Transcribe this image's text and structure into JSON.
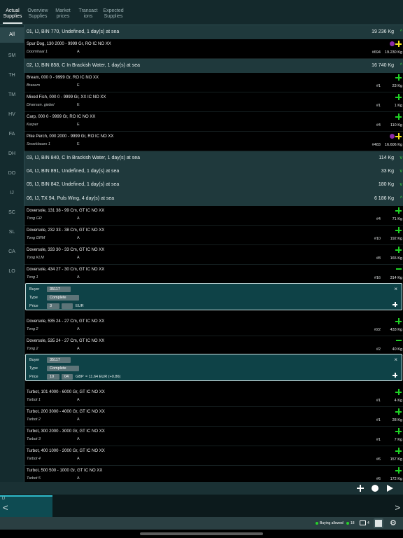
{
  "tabs": [
    {
      "label": "Actual\nSupplies",
      "active": true
    },
    {
      "label": "Overview\nSupplies"
    },
    {
      "label": "Market\nprices"
    },
    {
      "label": "Transact\nions"
    },
    {
      "label": "Expected\nSupplies"
    }
  ],
  "sidebar": [
    "All",
    "SM",
    "TH",
    "TM",
    "HV",
    "FA",
    "DH",
    "DO",
    "IJ",
    "SC",
    "SL",
    "CA",
    "LO"
  ],
  "groups": [
    {
      "title": "01, IJ, BIN 770, Undefined, 1 day(s) at sea",
      "weight": "19 236 Kg",
      "chevron": "^"
    },
    {
      "title": "02, IJ, BIN 858, C In Brackish Water, 1 day(s) at sea",
      "weight": "16 740 Kg",
      "chevron": "^"
    },
    {
      "title": "03, IJ, BIN 840, C In Brackish Water, 1 day(s) at sea",
      "weight": "114 Kg",
      "chevron": "v"
    },
    {
      "title": "04, IJ, BIN 891, Undefined, 1 day(s) at sea",
      "weight": "33 Kg",
      "chevron": "v"
    },
    {
      "title": "05, IJ, BIN 842, Undefined, 1 day(s) at sea",
      "weight": "180 Kg",
      "chevron": "v"
    },
    {
      "title": "06, IJ, TX 94, Puls Wing, 4 day(s) at sea",
      "weight": "6 186 Kg",
      "chevron": "^"
    }
  ],
  "rows": [
    {
      "name": "Spur Dog, 130 2000 - 9999 Gr, RO IC NO XX",
      "sub": "Doornhaai 1",
      "q": "A",
      "hash": "#694",
      "weight": "19.230 Kg",
      "icon": "plus-y",
      "dot": true
    },
    {
      "name": "Bream, 000 0 - 9999 Gr, RO IC NO XX",
      "sub": "Brasem",
      "q": "E",
      "hash": "#1",
      "weight": "23 Kg",
      "icon": "plus"
    },
    {
      "name": "Mixed Fish, 000 0 - 9999 Gr, XX IC NO XX",
      "sub": "Diversen. giebel",
      "q": "E",
      "hash": "#1",
      "weight": "1 Kg",
      "icon": "plus"
    },
    {
      "name": "Carp, 000 0 - 9999 Gr, RO IC NO XX",
      "sub": "Karper",
      "q": "E",
      "hash": "#4",
      "weight": "110 Kg",
      "icon": "plus"
    },
    {
      "name": "Pike Perch, 000 2000 - 9999 Gr, RO IC NO XX",
      "sub": "Snoekbaars 1",
      "q": "E",
      "hash": "#483",
      "weight": "16.606 Kg",
      "icon": "plus-y",
      "dot": true
    },
    {
      "name": "Doversole, 131 38 - 99 Cm, GT IC NO XX",
      "sub": "Tong GR",
      "q": "A",
      "hash": "#4",
      "weight": "71 Kg",
      "icon": "plus"
    },
    {
      "name": "Doversole, 232 33 - 38 Cm, GT IC NO XX",
      "sub": "Tong GRM",
      "q": "A",
      "hash": "#10",
      "weight": "192 Kg",
      "icon": "plus"
    },
    {
      "name": "Doversole, 333 30 - 33 Cm, GT IC NO XX",
      "sub": "Tong KLM",
      "q": "A",
      "hash": "#8",
      "weight": "165 Kg",
      "icon": "plus"
    },
    {
      "name": "Doversole, 434 27 - 30 Cm, GT IC NO XX",
      "sub": "Tong 1",
      "q": "A",
      "hash": "#16",
      "weight": "314 Kg",
      "icon": "minus"
    },
    {
      "name": "Doversole, 535 24 - 27 Cm, GT IC NO XX",
      "sub": "Tong 2",
      "q": "A",
      "hash": "#22",
      "weight": "433 Kg",
      "icon": "plus"
    },
    {
      "name": "Doversole, 535 24 - 27 Cm, GT IC NO XX",
      "sub": "Tong 2",
      "q": "A",
      "hash": "#2",
      "weight": "40 Kg",
      "icon": "minus"
    },
    {
      "name": "Turbot, 101 4000 - 6000 Gr, GT IC NO XX",
      "sub": "Tarbot 1",
      "q": "A",
      "hash": "#1",
      "weight": "4 Kg",
      "icon": "plus"
    },
    {
      "name": "Turbot, 200 3000 - 4000 Gr, GT IC NO XX",
      "sub": "Tarbot 2",
      "q": "A",
      "hash": "#1",
      "weight": "28 Kg",
      "icon": "plus"
    },
    {
      "name": "Turbot, 300 2000 - 3000 Gr, GT IC NO XX",
      "sub": "Tarbot 3",
      "q": "A",
      "hash": "#1",
      "weight": "7 Kg",
      "icon": "plus"
    },
    {
      "name": "Turbot, 400 1000 - 2000 Gr, GT IC NO XX",
      "sub": "Tarbot 4",
      "q": "A",
      "hash": "#6",
      "weight": "157 Kg",
      "icon": "plus"
    },
    {
      "name": "Turbot, 500 500 - 1000 Gr, GT IC NO XX",
      "sub": "Tarbot 5",
      "q": "A",
      "hash": "#6",
      "weight": "172 Kg",
      "icon": "plus"
    }
  ],
  "bid_labels": {
    "buyer": "Buyer",
    "type": "Type",
    "price": "Price",
    "close": "×"
  },
  "bids": [
    {
      "buyer": "35117",
      "type": "Complete",
      "price_int": "3",
      "price_dec": "",
      "currency": "EUR",
      "conversion": ""
    },
    {
      "buyer": "35117",
      "type": "Complete",
      "price_int": "10",
      "price_dec": "04",
      "currency": "GBP",
      "conversion": "= 11.64 EUR (+0.86)"
    }
  ],
  "strip": {
    "label": "IJ",
    "prev": "<",
    "next": ">"
  },
  "status": {
    "buying": "Buying allowed",
    "count": "18",
    "mail_count": "4"
  }
}
